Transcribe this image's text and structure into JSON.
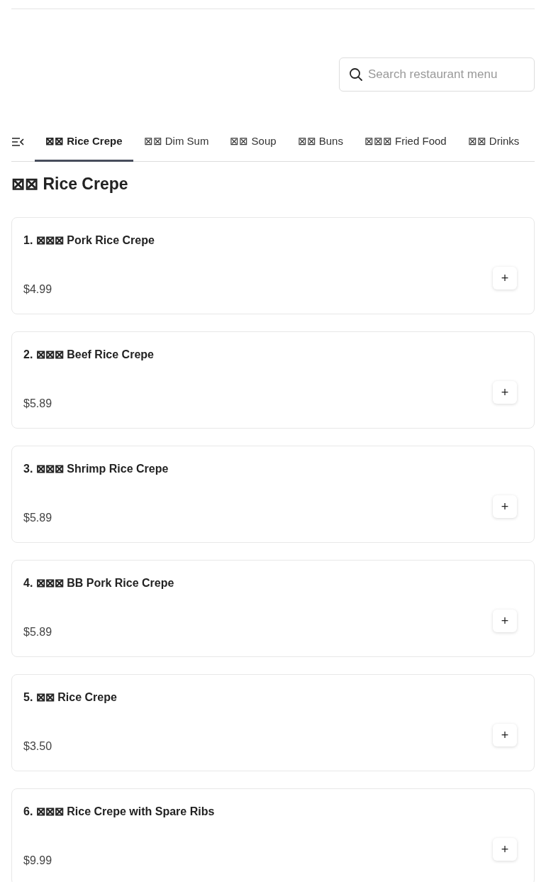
{
  "search": {
    "placeholder": "Search restaurant menu"
  },
  "tabs": [
    {
      "label": "⊠⊠ Rice Crepe",
      "selected": true
    },
    {
      "label": "⊠⊠ Dim Sum",
      "selected": false
    },
    {
      "label": "⊠⊠ Soup",
      "selected": false
    },
    {
      "label": "⊠⊠ Buns",
      "selected": false
    },
    {
      "label": "⊠⊠⊠ Fried Food",
      "selected": false
    },
    {
      "label": "⊠⊠ Drinks",
      "selected": false
    }
  ],
  "section_title": "⊠⊠ Rice Crepe",
  "items": [
    {
      "name": "1. ⊠⊠⊠ Pork Rice Crepe",
      "price": "$4.99",
      "add": "+"
    },
    {
      "name": "2. ⊠⊠⊠ Beef Rice Crepe",
      "price": "$5.89",
      "add": "+"
    },
    {
      "name": "3. ⊠⊠⊠ Shrimp Rice Crepe",
      "price": "$5.89",
      "add": "+"
    },
    {
      "name": "4. ⊠⊠⊠ BB Pork Rice Crepe",
      "price": "$5.89",
      "add": "+"
    },
    {
      "name": "5. ⊠⊠ Rice Crepe",
      "price": "$3.50",
      "add": "+"
    },
    {
      "name": "6. ⊠⊠⊠ Rice Crepe with Spare Ribs",
      "price": "$9.99",
      "add": "+"
    }
  ]
}
